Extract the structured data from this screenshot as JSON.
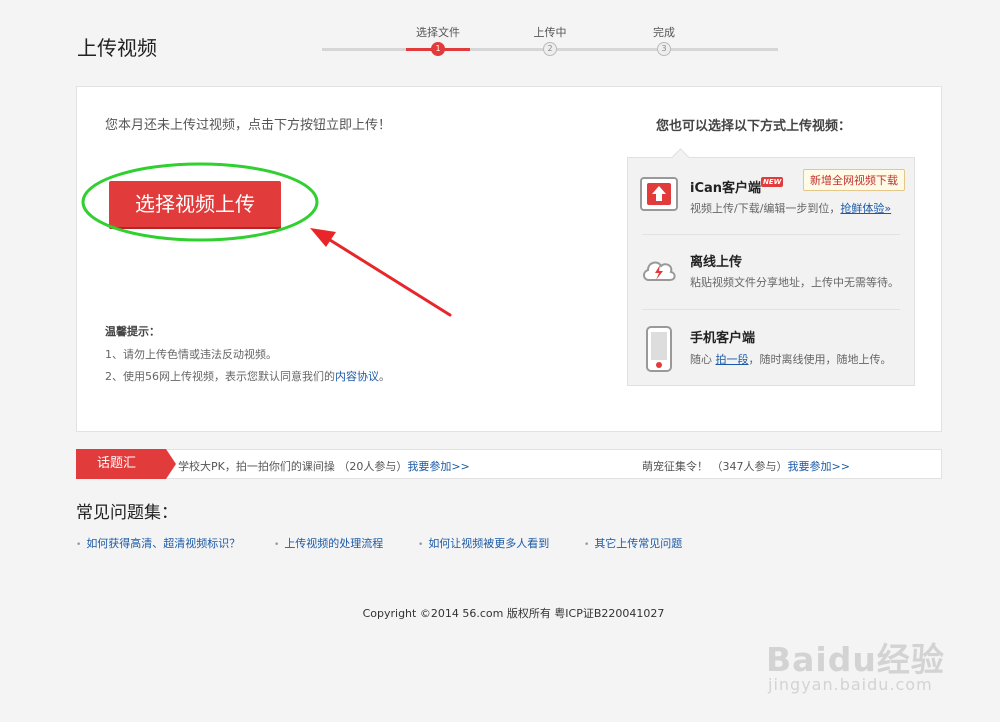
{
  "header": {
    "title": "上传视频"
  },
  "steps": [
    {
      "label": "选择文件",
      "num": "1"
    },
    {
      "label": "上传中",
      "num": "2"
    },
    {
      "label": "完成",
      "num": "3"
    }
  ],
  "main": {
    "notice": "您本月还未上传过视频，点击下方按钮立即上传！",
    "upload_button": "选择视频上传",
    "tips": {
      "title": "温馨提示：",
      "line1": "1、请勿上传色情或违法反动视频。",
      "line2_prefix": "2、使用56网上传视频，表示您默认同意我们的",
      "line2_link": "内容协议",
      "line2_suffix": "。"
    }
  },
  "side": {
    "heading": "您也可以选择以下方式上传视频：",
    "options": [
      {
        "title": "iCan客户端",
        "badge": "NEW",
        "desc": "视频上传/下载/编辑一步到位，",
        "link": "抢鲜体验»"
      },
      {
        "title": "离线上传",
        "desc": "粘贴视频文件分享地址，上传中无需等待。"
      },
      {
        "title": "手机客户端",
        "desc_prefix": "随心",
        "link": "拍一段",
        "desc_suffix": "，随时离线使用，随地上传。"
      }
    ],
    "tooltip": "新增全网视频下载"
  },
  "topic_bar": {
    "tag": "话题汇",
    "item1_text": "学校大PK，拍一拍你们的课间操 （20人参与）",
    "item1_link": "我要参加>>",
    "item2_text": "萌宠征集令！ （347人参与）",
    "item2_link": "我要参加>>"
  },
  "faq": {
    "title": "常见问题集：",
    "links": [
      "如何获得高清、超清视频标识？",
      "上传视频的处理流程",
      "如何让视频被更多人看到",
      "其它上传常见问题"
    ]
  },
  "footer": {
    "text": "Copyright ©2014 56.com 版权所有  粤ICP证B220041027"
  },
  "watermark": {
    "text": "Baidu经验",
    "url": "jingyan.baidu.com"
  },
  "colors": {
    "accent": "#e23b3b",
    "link": "#1c5aa6",
    "annotation": "#2fd02f"
  }
}
